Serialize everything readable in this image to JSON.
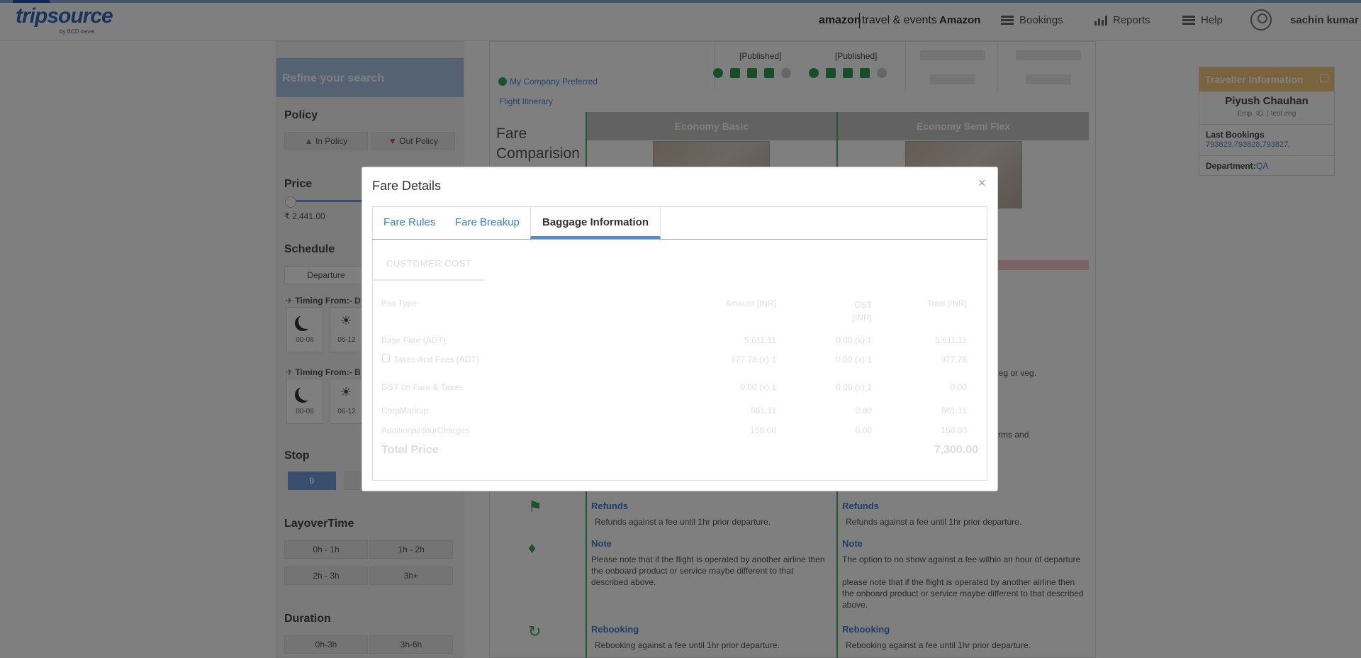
{
  "header": {
    "logo": "tripsource",
    "logo_sub": "by BCD travel",
    "brand_amazon": "amazon",
    "brand_te": "travel & events",
    "brand_name": "Amazon",
    "nav": [
      {
        "label": "Bookings",
        "icon": "hamburger-icon"
      },
      {
        "label": "Reports",
        "icon": "bar-chart-icon"
      },
      {
        "label": "Help",
        "icon": "hamburger-icon"
      }
    ],
    "user": "sachin kumar"
  },
  "sidebar": {
    "refine": "Refine your search",
    "policy_title": "Policy",
    "in_policy": "In Policy",
    "out_policy": "Out Policy",
    "price_title": "Price",
    "price_min": "₹ 2,441.00",
    "schedule_title": "Schedule",
    "departure": "Departure",
    "timing1": "Timing From:- D",
    "timing2": "Timing From:- B",
    "slot1": "00-06",
    "slot2": "06-12",
    "stop_title": "Stop",
    "stop_0": "0",
    "layover_title": "LayoverTime",
    "layover": [
      "0h - 1h",
      "1h - 2h",
      "2h - 3h",
      "3h+"
    ],
    "duration_title": "Duration",
    "duration": [
      "0h-3h",
      "3h-6h"
    ]
  },
  "center": {
    "published1": "[Published]",
    "published2": "[Published]",
    "preferred": "My Company Preferred",
    "itinerary": "Flight Itinerary",
    "fare_title": "Fare Comparision",
    "fare_cols": [
      "Economy Basic",
      "Economy Semi Flex"
    ],
    "snippet1": "on veg or veg.",
    "snippet2": "g terms and",
    "rows": [
      {
        "title": "Refunds",
        "col1": "Refunds against a fee until 1hr prior departure.",
        "col2": "Refunds against a fee until 1hr prior departure."
      },
      {
        "title": "Note",
        "col1": "Please note that if the flight is operated by another airline then the onboard product or service maybe different to that described above.",
        "col2": "The option to no show against a fee within an hour of departure\n\nplease note that if the flight is operated by another airline then the onboard product or service maybe different to that described above."
      },
      {
        "title": "Rebooking",
        "col1": "Rebooking against a fee until 1hr prior departure.",
        "col2": "Rebooking against a fee until 1hr prior departure."
      }
    ]
  },
  "traveller": {
    "header": "Traveller Information",
    "name": "Piyush Chauhan",
    "emp": "Emp. ID. | test eng",
    "last_bookings_label": "Last Bookings",
    "last_bookings": "793829,793828,793827,",
    "department_label": "Department",
    "department": "QA"
  },
  "modal": {
    "title": "Fare Details",
    "close": "×",
    "tabs": [
      "Fare Rules",
      "Fare Breakup",
      "Baggage Information"
    ],
    "active_tab": "Baggage Information",
    "cost_tab": "CUSTOMER COST",
    "columns": [
      "Pax Type",
      "Amount [INR]",
      "GST\n[INR]",
      "Total [INR]"
    ],
    "rows": [
      {
        "label": "Base Fare (ADT)",
        "amount": "5,611.11",
        "gst": "0.00 (x) 1",
        "total": "5,611.11"
      },
      {
        "label": "Taxes And Fees (ADT)",
        "amount": "977.78 (x) 1",
        "gst": "0.00 (x) 1",
        "total": "977.78"
      },
      {
        "label": "GST on Fare & Taxes",
        "amount": "0.00 (x) 1",
        "gst": "0.00 (x) 1",
        "total": "0.00"
      },
      {
        "label": "CorpMarkup",
        "amount": "561.11",
        "gst": "0.00",
        "total": "561.11"
      },
      {
        "label": "AdditionalHourCharges",
        "amount": "150.00",
        "gst": "0.00",
        "total": "150.00"
      }
    ],
    "total_label": "Total Price",
    "total_value": "7,300.00"
  }
}
